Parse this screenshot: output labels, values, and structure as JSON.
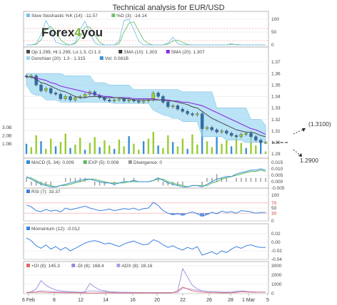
{
  "title": "Technical analysis for EUR/USD",
  "logo": {
    "text_a": "Forex",
    "text_b": "4",
    "text_c": "you"
  },
  "colors": {
    "stoch_k": "#7ac3e6",
    "stoch_d": "#6cc36c",
    "close": "#4a4a4a",
    "sma10": "#3a3a3a",
    "sma20": "#8a2be2",
    "donchian": "#9cd7f2",
    "vol_green": "#9acd32",
    "vol_blue": "#3a8fd6",
    "macd": "#2f8fd0",
    "ema": "#5cb85c",
    "divergence": "#999999",
    "rsi": "#3b82e0",
    "rsi_over": "#e94444",
    "momentum": "#3b82e0",
    "pdi": "#e06a6a",
    "mdi": "#9a8ad8",
    "adx": "#b0a0e0"
  },
  "chart_data": [
    {
      "type": "line",
      "panel": "stochastic",
      "legend": [
        "Slow Stochastic %K (14): -11.57",
        "%D (3): -14.14"
      ],
      "ticks": [
        "100",
        "50",
        "0"
      ],
      "series": [
        {
          "name": "Slow Stochastic %K (14): -11.57",
          "values": [
            0,
            0,
            5,
            40,
            95,
            60,
            10,
            5,
            0,
            0,
            10,
            60,
            92,
            50,
            8,
            0,
            0,
            0,
            0,
            15,
            95,
            100,
            60,
            15,
            0,
            0,
            0,
            0,
            0,
            8,
            30,
            5,
            0,
            0,
            0,
            0,
            0,
            0,
            0,
            0,
            0,
            0,
            5,
            0,
            0,
            0,
            0,
            0,
            0,
            0
          ]
        },
        {
          "name": "%D (3): -14.14",
          "values": [
            0,
            0,
            2,
            20,
            60,
            72,
            50,
            20,
            5,
            0,
            5,
            30,
            70,
            70,
            40,
            10,
            0,
            0,
            0,
            5,
            50,
            85,
            90,
            55,
            20,
            5,
            0,
            0,
            0,
            3,
            15,
            18,
            10,
            2,
            0,
            0,
            0,
            0,
            0,
            0,
            0,
            0,
            2,
            2,
            0,
            0,
            0,
            0,
            0,
            0
          ]
        }
      ]
    },
    {
      "type": "line",
      "panel": "price",
      "legend": [
        "Op:1.299, Hi:1.299, Lo:1.3, Cl:1.3",
        "SMA (10): 1.303",
        "SMA (20): 1.307",
        "Donchian (20): 1.3 - 1.315",
        "Vol: 0.081B"
      ],
      "ticks": [
        "1.37",
        "1.36",
        "1.35",
        "1.34",
        "1.33",
        "1.32",
        "1.31",
        "1.30",
        "1.29"
      ],
      "vol_ticks": [
        "3.0B",
        "2.0B",
        "1.0B"
      ],
      "ylim": [
        1.29,
        1.37
      ],
      "series": [
        {
          "name": "Op:1.299, Hi:1.299, Lo:1.3, Cl:1.3",
          "values": [
            1.357,
            1.358,
            1.35,
            1.345,
            1.347,
            1.343,
            1.342,
            1.338,
            1.34,
            1.337,
            1.339,
            1.34,
            1.342,
            1.344,
            1.341,
            1.339,
            1.337,
            1.336,
            1.337,
            1.338,
            1.336,
            1.337,
            1.336,
            1.335,
            1.336,
            1.337,
            1.343,
            1.34,
            1.335,
            1.331,
            1.332,
            1.329,
            1.327,
            1.325,
            1.324,
            1.325,
            1.312,
            1.313,
            1.311,
            1.309,
            1.31,
            1.308,
            1.306,
            1.305,
            1.307,
            1.308,
            1.305,
            1.302,
            1.3,
            1.3
          ]
        },
        {
          "name": "SMA (10): 1.303",
          "values": [
            1.357,
            1.357,
            1.355,
            1.352,
            1.351,
            1.349,
            1.347,
            1.345,
            1.344,
            1.342,
            1.34,
            1.339,
            1.339,
            1.34,
            1.34,
            1.34,
            1.339,
            1.339,
            1.339,
            1.339,
            1.338,
            1.338,
            1.337,
            1.337,
            1.337,
            1.337,
            1.337,
            1.337,
            1.337,
            1.336,
            1.336,
            1.335,
            1.334,
            1.333,
            1.331,
            1.33,
            1.327,
            1.324,
            1.321,
            1.319,
            1.317,
            1.315,
            1.313,
            1.311,
            1.31,
            1.309,
            1.309,
            1.308,
            1.306,
            1.305
          ]
        },
        {
          "name": "SMA (20): 1.307",
          "values": [
            1.357,
            1.357,
            1.356,
            1.355,
            1.354,
            1.352,
            1.351,
            1.349,
            1.348,
            1.347,
            1.346,
            1.345,
            1.344,
            1.343,
            1.342,
            1.341,
            1.34,
            1.34,
            1.339,
            1.339,
            1.339,
            1.339,
            1.338,
            1.338,
            1.338,
            1.338,
            1.338,
            1.337,
            1.337,
            1.337,
            1.336,
            1.336,
            1.335,
            1.335,
            1.334,
            1.333,
            1.332,
            1.33,
            1.328,
            1.326,
            1.324,
            1.322,
            1.32,
            1.318,
            1.316,
            1.314,
            1.312,
            1.311,
            1.309,
            1.307
          ]
        },
        {
          "name": "Donchian upper",
          "values": [
            1.36,
            1.36,
            1.36,
            1.36,
            1.36,
            1.36,
            1.36,
            1.36,
            1.358,
            1.358,
            1.358,
            1.358,
            1.358,
            1.358,
            1.352,
            1.352,
            1.352,
            1.35,
            1.35,
            1.35,
            1.35,
            1.35,
            1.346,
            1.346,
            1.346,
            1.346,
            1.346,
            1.346,
            1.346,
            1.346,
            1.346,
            1.346,
            1.344,
            1.344,
            1.344,
            1.344,
            1.344,
            1.344,
            1.344,
            1.33,
            1.33,
            1.33,
            1.33,
            1.33,
            1.33,
            1.33,
            1.32,
            1.32,
            1.32,
            1.315
          ]
        },
        {
          "name": "Donchian lower",
          "values": [
            1.35,
            1.343,
            1.341,
            1.341,
            1.337,
            1.337,
            1.337,
            1.335,
            1.335,
            1.335,
            1.335,
            1.335,
            1.335,
            1.335,
            1.335,
            1.335,
            1.335,
            1.335,
            1.334,
            1.334,
            1.334,
            1.334,
            1.334,
            1.334,
            1.334,
            1.334,
            1.328,
            1.326,
            1.324,
            1.323,
            1.321,
            1.321,
            1.318,
            1.318,
            1.318,
            1.318,
            1.305,
            1.305,
            1.305,
            1.305,
            1.305,
            1.302,
            1.302,
            1.302,
            1.302,
            1.3,
            1.3,
            1.3,
            1.3,
            1.3
          ]
        },
        {
          "name": "Vol: 0.081B",
          "values": [
            1.2,
            0.8,
            2.2,
            1.5,
            0.6,
            1.8,
            0.9,
            1.4,
            2.4,
            0.7,
            1.1,
            1.9,
            0.5,
            1.3,
            2.0,
            0.8,
            1.6,
            1.0,
            0.6,
            1.7,
            0.9,
            2.1,
            1.2,
            0.5,
            1.5,
            1.8,
            2.6,
            1.0,
            0.7,
            2.2,
            1.4,
            0.9,
            1.8,
            0.6,
            2.3,
            1.1,
            2.9,
            1.5,
            0.8,
            2.0,
            1.2,
            1.6,
            0.9,
            2.1,
            1.3,
            0.7,
            1.9,
            1.0,
            1.4,
            0.3
          ]
        }
      ]
    },
    {
      "type": "line",
      "panel": "macd",
      "legend": [
        "MACD (5, 34): 0.009",
        "EXP (5): 0.008",
        "Divergence: 0"
      ],
      "ticks": [
        "0.015",
        "0.010",
        "0.005",
        "0.000",
        "-0.005"
      ],
      "series": [
        {
          "name": "MACD (5, 34): 0.009",
          "values": [
            0.004,
            0.002,
            0.0,
            -0.002,
            -0.003,
            -0.004,
            -0.004,
            -0.003,
            -0.002,
            -0.001,
            0.0,
            0.001,
            0.002,
            0.002,
            0.001,
            0.0,
            -0.001,
            -0.001,
            -0.002,
            -0.001,
            0.0,
            0.0,
            0.001,
            0.0,
            0.0,
            0.0,
            0.001,
            0.003,
            0.001,
            -0.001,
            -0.002,
            -0.003,
            -0.004,
            -0.004,
            -0.003,
            -0.003,
            -0.004,
            -0.002,
            0.0,
            0.002,
            0.003,
            0.004,
            0.004,
            0.006,
            0.007,
            0.008,
            0.009,
            0.009,
            0.01,
            0.009
          ]
        },
        {
          "name": "EXP (5): 0.008",
          "values": [
            0.003,
            0.003,
            0.001,
            -0.001,
            -0.002,
            -0.003,
            -0.004,
            -0.003,
            -0.003,
            -0.002,
            -0.001,
            0.0,
            0.001,
            0.002,
            0.002,
            0.001,
            0.0,
            -0.001,
            -0.001,
            -0.001,
            -0.001,
            0.0,
            0.0,
            0.0,
            0.0,
            0.0,
            0.001,
            0.002,
            0.002,
            0.0,
            -0.001,
            -0.002,
            -0.003,
            -0.004,
            -0.003,
            -0.003,
            -0.003,
            -0.003,
            -0.001,
            0.0,
            0.002,
            0.003,
            0.004,
            0.005,
            0.006,
            0.007,
            0.008,
            0.008,
            0.009,
            0.008
          ]
        },
        {
          "name": "Divergence: 0",
          "values": [
            0.001,
            -0.001,
            -0.001,
            -0.001,
            -0.001,
            -0.001,
            0.0,
            0.0,
            0.001,
            0.001,
            0.001,
            0.001,
            0.001,
            0.0,
            -0.001,
            -0.001,
            -0.001,
            0.0,
            -0.001,
            0.0,
            0.001,
            0.0,
            0.001,
            0.0,
            0.0,
            0.0,
            0.0,
            0.001,
            -0.001,
            -0.001,
            -0.001,
            -0.001,
            -0.001,
            0.0,
            0.0,
            0.0,
            -0.001,
            0.001,
            0.001,
            0.002,
            0.001,
            0.001,
            0.0,
            0.001,
            0.001,
            0.001,
            0.001,
            0.001,
            0.001,
            0.001
          ]
        }
      ]
    },
    {
      "type": "line",
      "panel": "rsi",
      "legend": [
        "RSI (7): 33.37"
      ],
      "ticks": [
        "100",
        "70",
        "50",
        "30",
        "0"
      ],
      "series": [
        {
          "name": "RSI (7): 33.37",
          "values": [
            62,
            55,
            40,
            36,
            45,
            38,
            42,
            35,
            50,
            44,
            48,
            52,
            58,
            50,
            45,
            40,
            42,
            46,
            40,
            44,
            48,
            45,
            50,
            42,
            48,
            50,
            72,
            60,
            40,
            30,
            24,
            28,
            22,
            30,
            35,
            28,
            18,
            25,
            34,
            28,
            38,
            33,
            36,
            30,
            40,
            38,
            35,
            30,
            33,
            33
          ]
        }
      ]
    },
    {
      "type": "line",
      "panel": "momentum",
      "legend": [
        "Momentum (12): -0.012"
      ],
      "ticks": [
        "0.02",
        "0.00",
        "-0.02",
        "-0.04"
      ],
      "series": [
        {
          "name": "Momentum (12): -0.012",
          "values": [
            0.01,
            0.004,
            -0.008,
            -0.014,
            -0.006,
            -0.016,
            -0.01,
            -0.018,
            -0.012,
            -0.02,
            -0.014,
            -0.008,
            -0.002,
            0.002,
            0.004,
            0.001,
            -0.004,
            -0.002,
            -0.006,
            -0.01,
            -0.004,
            0.0,
            0.003,
            -0.002,
            -0.006,
            -0.004,
            0.006,
            0.002,
            -0.006,
            -0.012,
            -0.008,
            -0.014,
            -0.018,
            -0.012,
            -0.016,
            -0.01,
            -0.03,
            -0.026,
            -0.022,
            -0.028,
            -0.02,
            -0.024,
            -0.016,
            -0.01,
            -0.014,
            -0.008,
            -0.006,
            -0.01,
            -0.012,
            -0.012
          ]
        }
      ]
    },
    {
      "type": "line",
      "panel": "dmi",
      "legend": [
        "+DI (8): 145.3",
        "-DI (8): 168.4",
        "ADX (8): 28.16"
      ],
      "ticks": [
        "3000",
        "2000",
        "1000",
        "0"
      ],
      "series": [
        {
          "name": "+DI (8): 145.3",
          "values": [
            100,
            120,
            150,
            180,
            140,
            120,
            110,
            100,
            90,
            90,
            100,
            80,
            70,
            60,
            60,
            70,
            80,
            90,
            80,
            70,
            60,
            60,
            70,
            80,
            80,
            70,
            60,
            60,
            70,
            80,
            90,
            300,
            700,
            500,
            300,
            200,
            150,
            120,
            100,
            90,
            80,
            80,
            90,
            120,
            200,
            180,
            150,
            140,
            145,
            145
          ]
        },
        {
          "name": "-DI (8): 168.4",
          "values": [
            100,
            200,
            500,
            1400,
            900,
            600,
            400,
            300,
            250,
            200,
            180,
            150,
            200,
            1100,
            700,
            400,
            300,
            200,
            180,
            150,
            150,
            140,
            130,
            120,
            120,
            110,
            110,
            110,
            120,
            120,
            120,
            250,
            2700,
            1800,
            900,
            500,
            300,
            250,
            200,
            180,
            160,
            150,
            170,
            250,
            300,
            250,
            200,
            180,
            170,
            168
          ]
        },
        {
          "name": "ADX (8): 28.16",
          "values": [
            150,
            160,
            200,
            300,
            260,
            220,
            190,
            170,
            150,
            140,
            130,
            120,
            150,
            300,
            280,
            230,
            200,
            170,
            150,
            140,
            130,
            120,
            110,
            110,
            100,
            100,
            100,
            100,
            110,
            110,
            110,
            140,
            600,
            550,
            450,
            350,
            280,
            230,
            200,
            180,
            160,
            150,
            140,
            160,
            190,
            200,
            180,
            160,
            150,
            150
          ]
        }
      ]
    },
    {
      "type": "line",
      "panel": "date_axis",
      "categories": [
        "6 Feb",
        "8",
        "12",
        "14",
        "16",
        "20",
        "22",
        "26",
        "28",
        "1 Mar",
        "5"
      ]
    }
  ],
  "annotations": {
    "level_high": "(1.3100)",
    "level_low": "1.2900"
  }
}
